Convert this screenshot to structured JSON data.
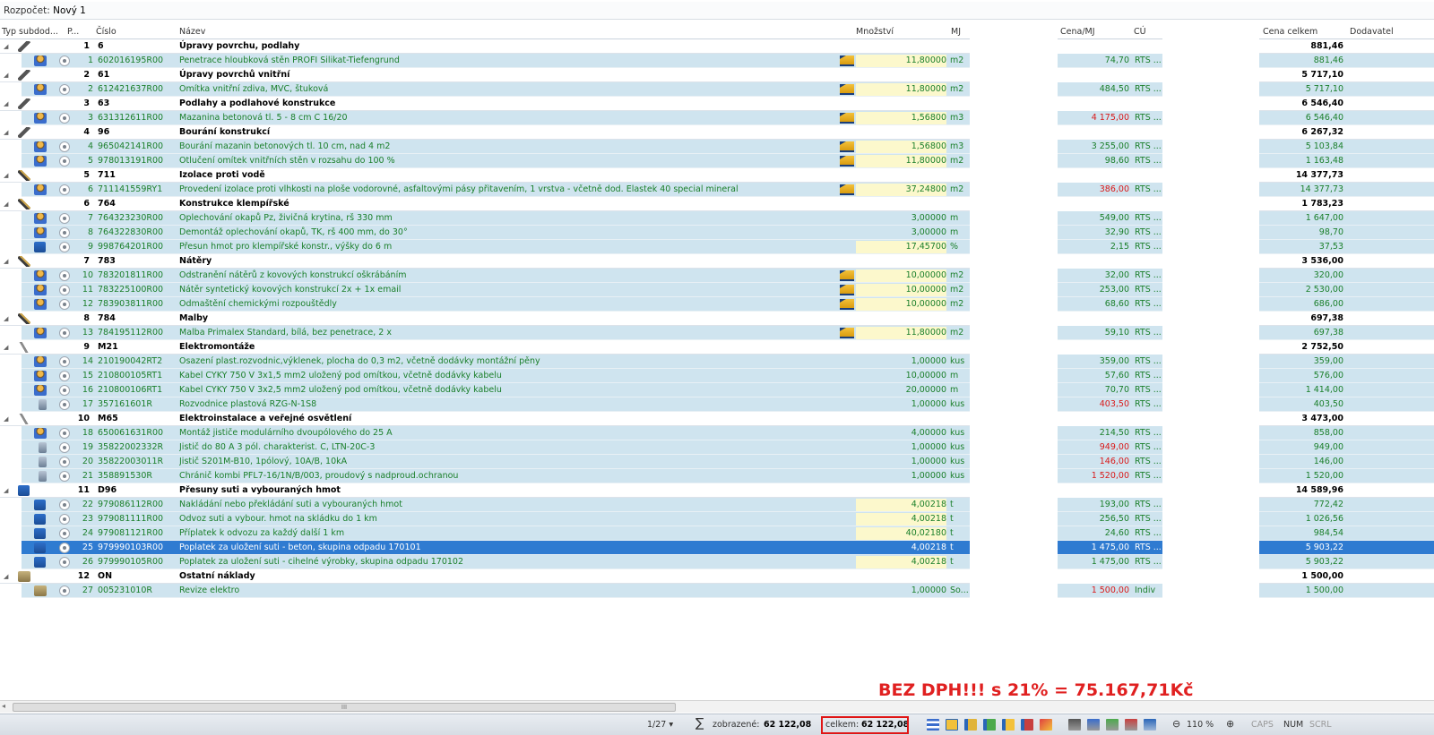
{
  "budget": {
    "label": "Rozpočet:",
    "name": "Nový 1"
  },
  "columns": {
    "typ": "Typ subdod...",
    "p": "P...",
    "cislo": "Číslo",
    "nazev": "Název",
    "mnozstvi": "Množství",
    "mj": "MJ",
    "cenamj": "Cena/MJ",
    "cu": "CÚ",
    "celkem": "Cena celkem",
    "dodavatel": "Dodavatel"
  },
  "rows": [
    {
      "kind": "sec",
      "icon": "tool",
      "n": "1",
      "code": "6",
      "name": "Úpravy povrchu, podlahy",
      "total": "881,46"
    },
    {
      "kind": "item",
      "icon": "worker",
      "n": "1",
      "code": "602016195R00",
      "name": "Penetrace hloubková stěn PROFI Silikat-Tiefengrund",
      "pencil": true,
      "qty": "11,80000",
      "unit": "m2",
      "price": "74,70",
      "price_red": false,
      "cu": "RTS ...",
      "total": "881,46",
      "yellow": true
    },
    {
      "kind": "sec",
      "icon": "tool",
      "n": "2",
      "code": "61",
      "name": "Úpravy povrchů vnitřní",
      "total": "5 717,10"
    },
    {
      "kind": "item",
      "icon": "worker",
      "n": "2",
      "code": "612421637R00",
      "name": "Omítka vnitřní zdiva, MVC, štuková",
      "pencil": true,
      "qty": "11,80000",
      "unit": "m2",
      "price": "484,50",
      "price_red": false,
      "cu": "RTS ...",
      "total": "5 717,10",
      "yellow": true
    },
    {
      "kind": "sec",
      "icon": "tool",
      "n": "3",
      "code": "63",
      "name": "Podlahy a podlahové konstrukce",
      "total": "6 546,40"
    },
    {
      "kind": "item",
      "icon": "worker",
      "n": "3",
      "code": "631312611R00",
      "name": "Mazanina betonová tl. 5 - 8 cm C 16/20",
      "pencil": true,
      "qty": "1,56800",
      "unit": "m3",
      "price": "4 175,00",
      "price_red": true,
      "cu": "RTS ...",
      "total": "6 546,40",
      "yellow": true
    },
    {
      "kind": "sec",
      "icon": "tool",
      "n": "4",
      "code": "96",
      "name": "Bourání konstrukcí",
      "total": "6 267,32"
    },
    {
      "kind": "item",
      "icon": "worker",
      "n": "4",
      "code": "965042141R00",
      "name": "Bourání mazanin betonových tl. 10 cm, nad 4 m2",
      "pencil": true,
      "qty": "1,56800",
      "unit": "m3",
      "price": "3 255,00",
      "price_red": false,
      "cu": "RTS ...",
      "total": "5 103,84",
      "yellow": true
    },
    {
      "kind": "item",
      "icon": "worker",
      "n": "5",
      "code": "978013191R00",
      "name": "Otlučení omítek vnitřních stěn v rozsahu do 100 %",
      "pencil": true,
      "qty": "11,80000",
      "unit": "m2",
      "price": "98,60",
      "price_red": false,
      "cu": "RTS ...",
      "total": "1 163,48",
      "yellow": true
    },
    {
      "kind": "sec",
      "icon": "brush",
      "n": "5",
      "code": "711",
      "name": "Izolace proti vodě",
      "total": "14 377,73"
    },
    {
      "kind": "item",
      "icon": "worker",
      "n": "6",
      "code": "711141559RY1",
      "name": "Provedení izolace proti vlhkosti na ploše vodorovné, asfaltovými pásy přitavením, 1 vrstva - včetně dod. Elastek 40 special mineral",
      "pencil": true,
      "qty": "37,24800",
      "unit": "m2",
      "price": "386,00",
      "price_red": true,
      "cu": "RTS ...",
      "total": "14 377,73",
      "yellow": true
    },
    {
      "kind": "sec",
      "icon": "brush",
      "n": "6",
      "code": "764",
      "name": "Konstrukce klempířské",
      "total": "1 783,23"
    },
    {
      "kind": "item",
      "icon": "worker",
      "n": "7",
      "code": "764323230R00",
      "name": "Oplechování okapů Pz, živičná krytina, rš 330 mm",
      "pencil": false,
      "qty": "3,00000",
      "unit": "m",
      "price": "549,00",
      "price_red": false,
      "cu": "RTS ...",
      "total": "1 647,00",
      "yellow": false
    },
    {
      "kind": "item",
      "icon": "worker",
      "n": "8",
      "code": "764322830R00",
      "name": "Demontáž oplechování okapů, TK, rš 400 mm, do 30°",
      "pencil": false,
      "qty": "3,00000",
      "unit": "m",
      "price": "32,90",
      "price_red": false,
      "cu": "RTS ...",
      "total": "98,70",
      "yellow": false
    },
    {
      "kind": "item",
      "icon": "truck",
      "n": "9",
      "code": "998764201R00",
      "name": "Přesun hmot pro klempířské konstr., výšky do 6 m",
      "pencil": false,
      "qty": "17,45700",
      "unit": "%",
      "price": "2,15",
      "price_red": false,
      "cu": "RTS ...",
      "total": "37,53",
      "yellow": true
    },
    {
      "kind": "sec",
      "icon": "brush",
      "n": "7",
      "code": "783",
      "name": "Nátěry",
      "total": "3 536,00"
    },
    {
      "kind": "item",
      "icon": "worker",
      "n": "10",
      "code": "783201811R00",
      "name": "Odstranění nátěrů z kovových konstrukcí oškrábáním",
      "pencil": true,
      "qty": "10,00000",
      "unit": "m2",
      "price": "32,00",
      "price_red": false,
      "cu": "RTS ...",
      "total": "320,00",
      "yellow": true
    },
    {
      "kind": "item",
      "icon": "worker",
      "n": "11",
      "code": "783225100R00",
      "name": "Nátěr syntetický kovových konstrukcí 2x + 1x email",
      "pencil": true,
      "qty": "10,00000",
      "unit": "m2",
      "price": "253,00",
      "price_red": false,
      "cu": "RTS ...",
      "total": "2 530,00",
      "yellow": true
    },
    {
      "kind": "item",
      "icon": "worker",
      "n": "12",
      "code": "783903811R00",
      "name": "Odmaštění chemickými rozpouštědly",
      "pencil": true,
      "qty": "10,00000",
      "unit": "m2",
      "price": "68,60",
      "price_red": false,
      "cu": "RTS ...",
      "total": "686,00",
      "yellow": true
    },
    {
      "kind": "sec",
      "icon": "brush",
      "n": "8",
      "code": "784",
      "name": "Malby",
      "total": "697,38"
    },
    {
      "kind": "item",
      "icon": "worker",
      "n": "13",
      "code": "784195112R00",
      "name": "Malba Primalex Standard, bílá, bez penetrace, 2 x",
      "pencil": true,
      "qty": "11,80000",
      "unit": "m2",
      "price": "59,10",
      "price_red": false,
      "cu": "RTS ...",
      "total": "697,38",
      "yellow": true
    },
    {
      "kind": "sec",
      "icon": "wrench",
      "n": "9",
      "code": "M21",
      "name": "Elektromontáže",
      "total": "2 752,50"
    },
    {
      "kind": "item",
      "icon": "worker",
      "n": "14",
      "code": "210190042RT2",
      "name": "Osazení plast.rozvodnic,výklenek, plocha do 0,3 m2, včetně dodávky montážní pěny",
      "pencil": false,
      "qty": "1,00000",
      "unit": "kus",
      "price": "359,00",
      "price_red": false,
      "cu": "RTS ...",
      "total": "359,00",
      "yellow": false
    },
    {
      "kind": "item",
      "icon": "worker",
      "n": "15",
      "code": "210800105RT1",
      "name": "Kabel CYKY 750 V 3x1,5 mm2 uložený pod omítkou, včetně dodávky kabelu",
      "pencil": false,
      "qty": "10,00000",
      "unit": "m",
      "price": "57,60",
      "price_red": false,
      "cu": "RTS ...",
      "total": "576,00",
      "yellow": false
    },
    {
      "kind": "item",
      "icon": "worker",
      "n": "16",
      "code": "210800106RT1",
      "name": "Kabel CYKY 750 V 3x2,5 mm2 uložený pod omítkou, včetně dodávky kabelu",
      "pencil": false,
      "qty": "20,00000",
      "unit": "m",
      "price": "70,70",
      "price_red": false,
      "cu": "RTS ...",
      "total": "1 414,00",
      "yellow": false
    },
    {
      "kind": "item",
      "icon": "device",
      "n": "17",
      "code": "357161601R",
      "name": "Rozvodnice plastová RZG-N-1S8",
      "pencil": false,
      "qty": "1,00000",
      "unit": "kus",
      "price": "403,50",
      "price_red": true,
      "cu": "RTS ...",
      "total": "403,50",
      "yellow": false
    },
    {
      "kind": "sec",
      "icon": "wrench",
      "n": "10",
      "code": "M65",
      "name": "Elektroinstalace a veřejné osvětlení",
      "total": "3 473,00"
    },
    {
      "kind": "item",
      "icon": "worker",
      "n": "18",
      "code": "650061631R00",
      "name": "Montáž jističe modulárního dvoupólového do 25 A",
      "pencil": false,
      "qty": "4,00000",
      "unit": "kus",
      "price": "214,50",
      "price_red": false,
      "cu": "RTS ...",
      "total": "858,00",
      "yellow": false
    },
    {
      "kind": "item",
      "icon": "device",
      "n": "19",
      "code": "35822002332R",
      "name": "Jistič do 80 A 3 pól. charakterist. C, LTN-20C-3",
      "pencil": false,
      "qty": "1,00000",
      "unit": "kus",
      "price": "949,00",
      "price_red": true,
      "cu": "RTS ...",
      "total": "949,00",
      "yellow": false
    },
    {
      "kind": "item",
      "icon": "device",
      "n": "20",
      "code": "35822003011R",
      "name": "Jistič S201M-B10, 1pólový, 10A/B, 10kA",
      "pencil": false,
      "qty": "1,00000",
      "unit": "kus",
      "price": "146,00",
      "price_red": true,
      "cu": "RTS ...",
      "total": "146,00",
      "yellow": false
    },
    {
      "kind": "item",
      "icon": "device",
      "n": "21",
      "code": "358891530R",
      "name": "Chránič kombi PFL7-16/1N/B/003, proudový s nadproud.ochranou",
      "pencil": false,
      "qty": "1,00000",
      "unit": "kus",
      "price": "1 520,00",
      "price_red": true,
      "cu": "RTS ...",
      "total": "1 520,00",
      "yellow": false
    },
    {
      "kind": "sec",
      "icon": "truck",
      "n": "11",
      "code": "D96",
      "name": "Přesuny suti a vybouraných hmot",
      "total": "14 589,96"
    },
    {
      "kind": "item",
      "icon": "truck",
      "n": "22",
      "code": "979086112R00",
      "name": "Nakládání nebo překládání suti a vybouraných hmot",
      "pencil": false,
      "qty": "4,00218",
      "unit": "t",
      "price": "193,00",
      "price_red": false,
      "cu": "RTS ...",
      "total": "772,42",
      "yellow": true
    },
    {
      "kind": "item",
      "icon": "truck",
      "n": "23",
      "code": "979081111R00",
      "name": "Odvoz suti a vybour. hmot na skládku do 1 km",
      "pencil": false,
      "qty": "4,00218",
      "unit": "t",
      "price": "256,50",
      "price_red": false,
      "cu": "RTS ...",
      "total": "1 026,56",
      "yellow": true
    },
    {
      "kind": "item",
      "icon": "truck",
      "n": "24",
      "code": "979081121R00",
      "name": "Příplatek k odvozu za každý další 1 km",
      "pencil": false,
      "qty": "40,02180",
      "unit": "t",
      "price": "24,60",
      "price_red": false,
      "cu": "RTS ...",
      "total": "984,54",
      "yellow": true
    },
    {
      "kind": "item",
      "icon": "truck",
      "n": "25",
      "code": "979990103R00",
      "name": "Poplatek za uložení suti - beton, skupina odpadu 170101",
      "pencil": false,
      "qty": "4,00218",
      "unit": "t",
      "price": "1 475,00",
      "price_red": false,
      "cu": "RTS ...",
      "total": "5 903,22",
      "yellow": true,
      "selected": true
    },
    {
      "kind": "item",
      "icon": "truck",
      "n": "26",
      "code": "979990105R00",
      "name": "Poplatek za uložení suti - cihelné výrobky, skupina odpadu 170102",
      "pencil": false,
      "qty": "4,00218",
      "unit": "t",
      "price": "1 475,00",
      "price_red": false,
      "cu": "RTS ...",
      "total": "5 903,22",
      "yellow": true
    },
    {
      "kind": "sec",
      "icon": "box",
      "n": "12",
      "code": "ON",
      "name": "Ostatní náklady",
      "total": "1 500,00"
    },
    {
      "kind": "item",
      "icon": "box",
      "n": "27",
      "code": "005231010R",
      "name": "Revize elektro",
      "pencil": false,
      "qty": "1,00000",
      "unit": "So...",
      "price": "1 500,00",
      "price_red": true,
      "cu": "Indiv",
      "total": "1 500,00",
      "yellow": false
    }
  ],
  "status": {
    "page": "1/27 ▾",
    "sigma": "∑",
    "shown_label": "zobrazené:",
    "shown_value": "62 122,08",
    "total_label": "celkem:",
    "total_value": "62 122,08",
    "zoom": "110 %",
    "caps": "CAPS",
    "num": "NUM",
    "scrl": "SCRL",
    "scroll_thumb": "III"
  },
  "annotation": "BEZ DPH!!! s 21% = 75.167,71Kč",
  "colors": {
    "green_text": "#1a7f2a",
    "red_price": "#d91a1a",
    "selection": "#2f7bd1",
    "row_blue": "#cfe4ef",
    "qty_yellow": "#fcf8cc",
    "annotation_red": "#e02020"
  }
}
